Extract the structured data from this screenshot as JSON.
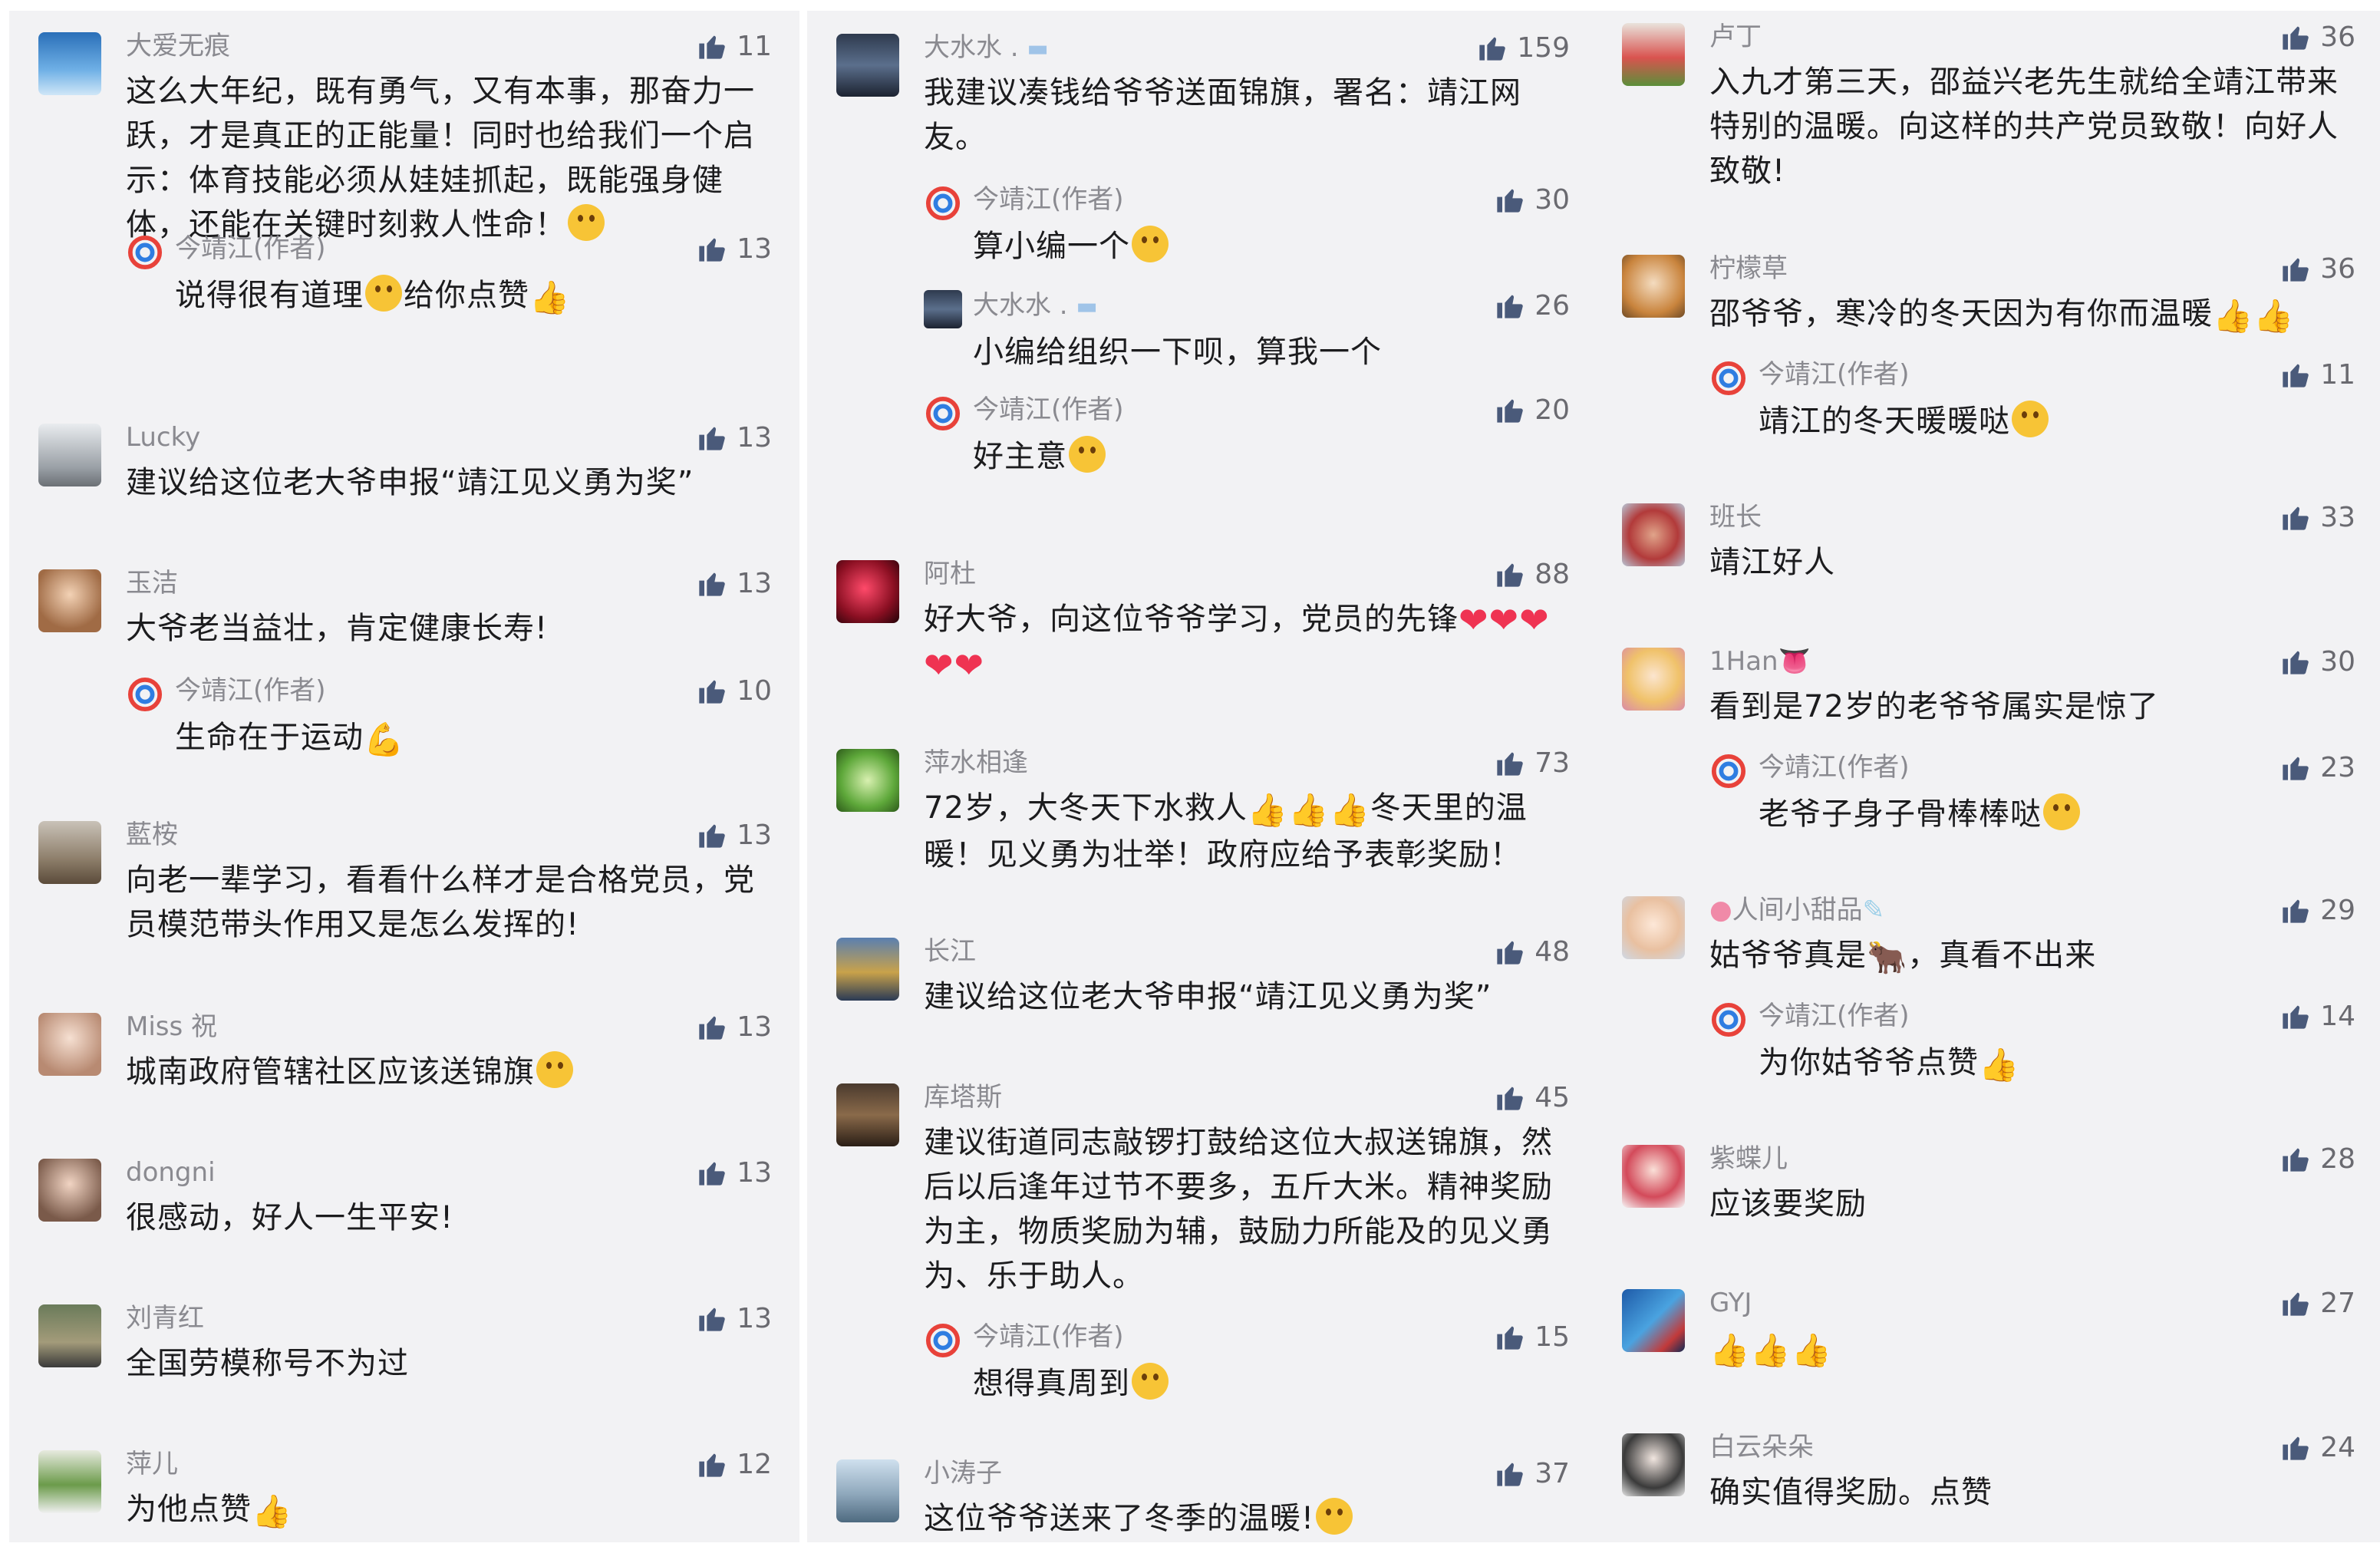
{
  "col1": [
    {
      "name": "大爱无痕",
      "likes": "11",
      "text": "这么大年纪，既有勇气，又有本事，那奋力一跃，才是真正的正能量！同时也给我们一个启示：体育技能必须从娃娃抓起，既能强身健体，还能在关键时刻救人性命！",
      "reply": {
        "name": "今靖江(作者)",
        "likes": "13",
        "text": "说得很有道理",
        "text2": "给你点赞"
      }
    },
    {
      "name": "Lucky",
      "likes": "13",
      "text": "建议给这位老大爷申报“靖江见义勇为奖”"
    },
    {
      "name": "玉洁",
      "likes": "13",
      "text": "大爷老当益壮，肯定健康长寿!",
      "reply": {
        "name": "今靖江(作者)",
        "likes": "10",
        "text": "生命在于运动"
      }
    },
    {
      "name": "藍桉",
      "likes": "13",
      "text": "向老一辈学习，看看什么样才是合格党员，党员模范带头作用又是怎么发挥的!"
    },
    {
      "name": "Miss 祝",
      "likes": "13",
      "text": "城南政府管辖社区应该送锦旗"
    },
    {
      "name": "dongni",
      "likes": "13",
      "text": "很感动，好人一生平安!"
    },
    {
      "name": "刘青红",
      "likes": "13",
      "text": "全国劳模称号不为过"
    },
    {
      "name": "萍儿",
      "likes": "12",
      "text": "为他点赞"
    }
  ],
  "col2": [
    {
      "name": "大水水 .",
      "likes": "159",
      "text": "我建议凑钱给爷爷送面锦旗，署名：靖江网友。",
      "replies": [
        {
          "name": "今靖江(作者)",
          "likes": "30",
          "text": "算小编一个"
        },
        {
          "name": "大水水 .",
          "likes": "26",
          "text": "小编给组织一下呗，算我一个"
        },
        {
          "name": "今靖江(作者)",
          "likes": "20",
          "text": "好主意"
        }
      ]
    },
    {
      "name": "阿杜",
      "likes": "88",
      "text": "好大爷，向这位爷爷学习，党员的先锋"
    },
    {
      "name": "萍水相逢",
      "likes": "73",
      "text": "72岁，大冬天下水救人",
      "text2": "冬天里的温暖！见义勇为壮举！政府应给予表彰奖励！"
    },
    {
      "name": "长江",
      "likes": "48",
      "text": "建议给这位老大爷申报“靖江见义勇为奖”"
    },
    {
      "name": "库塔斯",
      "likes": "45",
      "text": "建议街道同志敲锣打鼓给这位大叔送锦旗，然后以后逢年过节不要多，五斤大米。精神奖励为主，物质奖励为辅，鼓励力所能及的见义勇为、乐于助人。",
      "reply": {
        "name": "今靖江(作者)",
        "likes": "15",
        "text": "想得真周到"
      }
    },
    {
      "name": "小涛子",
      "likes": "37",
      "text": "这位爷爷送来了冬季的温暖!"
    }
  ],
  "col3": [
    {
      "name": "卢丁",
      "likes": "36",
      "text": "入九才第三天，邵益兴老先生就给全靖江带来特别的温暖。向这样的共产党员致敬！向好人致敬!"
    },
    {
      "name": "柠檬草",
      "likes": "36",
      "text": "邵爷爷，寒冷的冬天因为有你而温暖",
      "reply": {
        "name": "今靖江(作者)",
        "likes": "11",
        "text": "靖江的冬天暖暖哒"
      }
    },
    {
      "name": "班长",
      "likes": "33",
      "text": "靖江好人"
    },
    {
      "name": "1Han",
      "likes": "30",
      "text": "看到是72岁的老爷爷属实是惊了",
      "reply": {
        "name": "今靖江(作者)",
        "likes": "23",
        "text": "老爷子身子骨棒棒哒"
      }
    },
    {
      "name": "人间小甜品",
      "likes": "29",
      "text": "姑爷爷真是",
      "text2": "，真看不出来",
      "reply": {
        "name": "今靖江(作者)",
        "likes": "14",
        "text": "为你姑爷爷点赞"
      }
    },
    {
      "name": "紫蝶儿",
      "likes": "28",
      "text": "应该要奖励"
    },
    {
      "name": "GYJ",
      "likes": "27",
      "text": ""
    },
    {
      "name": "白云朵朵",
      "likes": "24",
      "text": "确实值得奖励。点赞"
    }
  ],
  "colors": {
    "panel": "#f2f2f4",
    "name": "#8a8a90",
    "text": "#1c1c1e",
    "like": "#6a6a70",
    "thumb": "#4a5a7a"
  },
  "icons": {
    "like": "thumb-up-icon",
    "author": "jinjingjiang-logo-icon"
  }
}
